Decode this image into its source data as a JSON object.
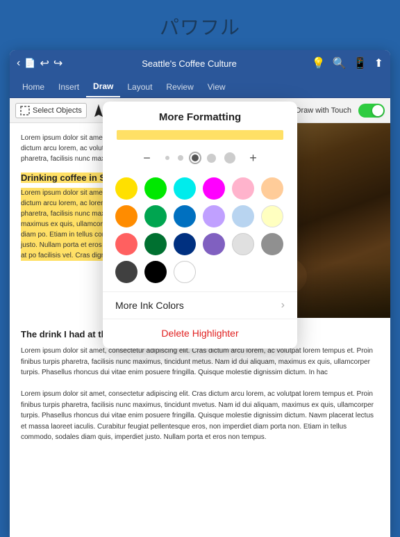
{
  "app": {
    "top_title": "パワフル"
  },
  "toolbar": {
    "title": "Seattle's Coffee Culture",
    "back_label": "‹",
    "file_icon": "📄",
    "undo_icon": "↩",
    "redo_icon": "↪",
    "bulb_icon": "💡",
    "search_icon": "🔍",
    "phone_icon": "📱",
    "share_icon": "⬆"
  },
  "tabs": [
    {
      "label": "Home",
      "active": false
    },
    {
      "label": "Insert",
      "active": false
    },
    {
      "label": "Draw",
      "active": true
    },
    {
      "label": "Layout",
      "active": false
    },
    {
      "label": "Review",
      "active": false
    },
    {
      "label": "View",
      "active": false
    }
  ],
  "draw_toolbar": {
    "select_objects": "Select Objects",
    "draw_with_touch": "Draw with Touch",
    "plus_label": "+"
  },
  "document": {
    "para1": "Lorem ipsum dolor sit amet, consectetur adipiscing elit. Cras dictum arcu lorem, ac volutpat lorem tempus et. Proin finibus turpis pharetra, facilisis nunc maximus, tincidunt metus.",
    "heading1": "Drinking coffee in Seattle",
    "para2": "Lorem ipsum dolor sit amet, consectetur adipiscing elit. Cras dictum arcu lorem, ac lorem tempus et. Proin finibus turpis pharetra, facilisis nunc maximus, tincidunt metus. Na dui aliquam, maximus ex quis, ullamcorper pellentesque eros, non imperdiet diam po. Etiam in tellus commodo, sodales diam qu, imperdiet justo. Nullam porta et eros no. Suspendisse interdum quam felis, at po facilisis vel. Cras dignissim vitae tortor v",
    "heading2": "The drink I had at the roastery",
    "para3": "Lorem ipsum dolor sit amet, consectetur adipiscing elit. Cras dictum arcu lorem, ac volutpat lorem tempus et. Proin finibus turpis pharetra, facilisis nunc maximus, tincidunt metus. Nam id dui aliquam, maximus ex quis, ullamcorper turpis. Phasellus rhoncus dui vitae enim posuere fringilla. Quisque molestie dignissim dictum. In hac",
    "para4": "Lorem ipsum dolor sit amet, consectetur adipiscing elit. Cras dictum arcu lorem, ac volutpat lorem tempus et. Proin finibus turpis pharetra, facilisis nunc maximus, tincidunt mvetus. Nam id dui aliquam, maximus ex quis, ullamcorper turpis. Phasellus rhoncus dui vitae enim posuere fringilla. Quisque molestie dignissim dictum. Navm placerat lectus et massa laoreet iaculis. Curabitur feugiat pellentesque eros, non imperdiet diam porta non. Etiam in tellus commodo, sodales diam quis, imperdiet justo. Nullam porta et eros non tempus."
  },
  "popup": {
    "title": "More Formatting",
    "size_minus": "−",
    "size_plus": "+",
    "dots": [
      {
        "size": 6,
        "active": false
      },
      {
        "size": 8,
        "active": false
      },
      {
        "size": 10,
        "active": true
      },
      {
        "size": 13,
        "active": false
      },
      {
        "size": 16,
        "active": false
      }
    ],
    "colors": [
      {
        "name": "yellow",
        "hex": "#FFE000",
        "border": false
      },
      {
        "name": "bright-green",
        "hex": "#00E800",
        "border": false
      },
      {
        "name": "cyan",
        "hex": "#00ECEC",
        "border": false
      },
      {
        "name": "magenta",
        "hex": "#FF00FF",
        "border": false
      },
      {
        "name": "light-pink",
        "hex": "#FFB3CC",
        "border": false
      },
      {
        "name": "peach",
        "hex": "#FFCC99",
        "border": false
      },
      {
        "name": "orange",
        "hex": "#FF8C00",
        "border": false
      },
      {
        "name": "green",
        "hex": "#00A550",
        "border": false
      },
      {
        "name": "blue",
        "hex": "#0070C0",
        "border": false
      },
      {
        "name": "lavender",
        "hex": "#C0A0FF",
        "border": false
      },
      {
        "name": "light-blue",
        "hex": "#B8D4F0",
        "border": false
      },
      {
        "name": "light-yellow",
        "hex": "#FFFFC0",
        "border": false
      },
      {
        "name": "red-light",
        "hex": "#FF6060",
        "border": false
      },
      {
        "name": "dark-green",
        "hex": "#007030",
        "border": false
      },
      {
        "name": "dark-blue",
        "hex": "#003080",
        "border": false
      },
      {
        "name": "purple",
        "hex": "#8060C0",
        "border": false
      },
      {
        "name": "light-gray",
        "hex": "#E0E0E0",
        "border": true
      },
      {
        "name": "medium-gray",
        "hex": "#909090",
        "border": false
      },
      {
        "name": "dark-gray",
        "hex": "#404040",
        "border": false
      },
      {
        "name": "black",
        "hex": "#000000",
        "border": false
      },
      {
        "name": "white",
        "hex": "#FFFFFF",
        "border": true
      },
      {
        "name": "empty1",
        "hex": "",
        "border": false
      },
      {
        "name": "empty2",
        "hex": "",
        "border": false
      },
      {
        "name": "empty3",
        "hex": "",
        "border": false
      }
    ],
    "more_ink_colors": "More Ink Colors",
    "delete_highlighter": "Delete Highlighter"
  }
}
